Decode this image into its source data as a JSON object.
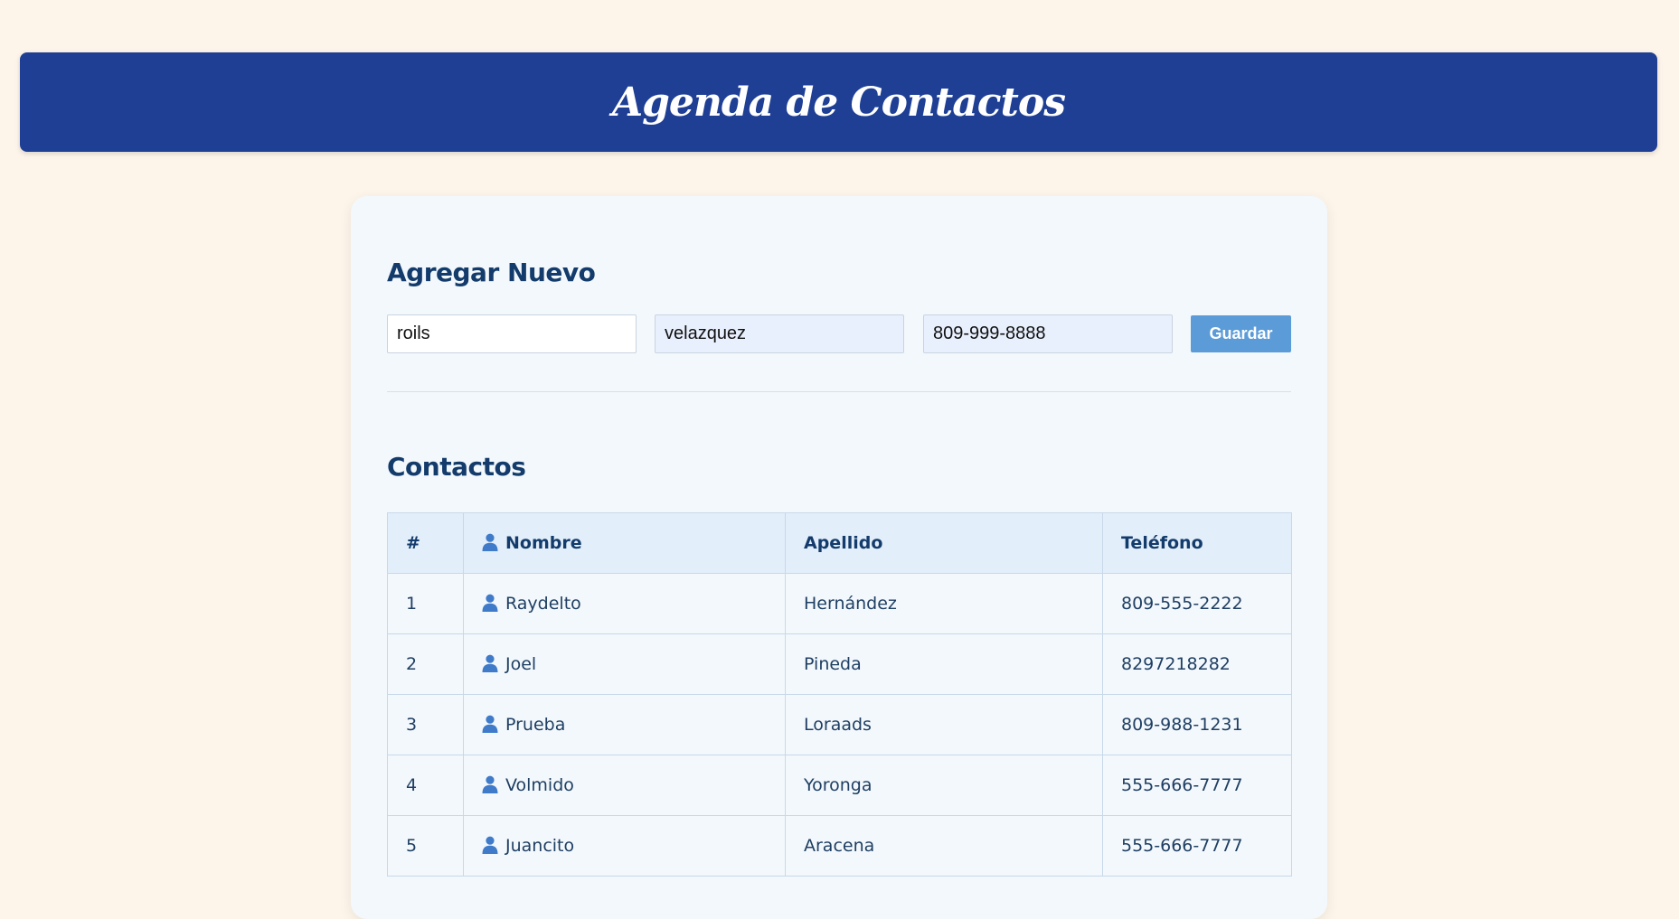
{
  "header": {
    "title": "Agenda de Contactos"
  },
  "add_section": {
    "title": "Agregar Nuevo",
    "nombre_value": "roils",
    "apellido_value": "velazquez",
    "telefono_value": "809-999-8888",
    "save_label": "Guardar"
  },
  "contacts_section": {
    "title": "Contactos",
    "columns": [
      "#",
      "Nombre",
      "Apellido",
      "Teléfono"
    ],
    "rows": [
      {
        "num": "1",
        "nombre": "Raydelto",
        "apellido": "Hernández",
        "telefono": "809-555-2222"
      },
      {
        "num": "2",
        "nombre": "Joel",
        "apellido": "Pineda",
        "telefono": "8297218282"
      },
      {
        "num": "3",
        "nombre": "Prueba",
        "apellido": "Loraads",
        "telefono": "809-988-1231"
      },
      {
        "num": "4",
        "nombre": "Volmido",
        "apellido": "Yoronga",
        "telefono": "555-666-7777"
      },
      {
        "num": "5",
        "nombre": "Juancito",
        "apellido": "Aracena",
        "telefono": "555-666-7777"
      }
    ]
  },
  "icons": {
    "person": "person-icon"
  },
  "colors": {
    "page_background": "#fdf5ea",
    "header_background": "#1e3f94",
    "card_background": "#f3f8fc",
    "title_text": "#133b6b",
    "button_background": "#5b9bd8",
    "table_header_background": "#e2eefa",
    "icon": "#3f7bc9"
  }
}
